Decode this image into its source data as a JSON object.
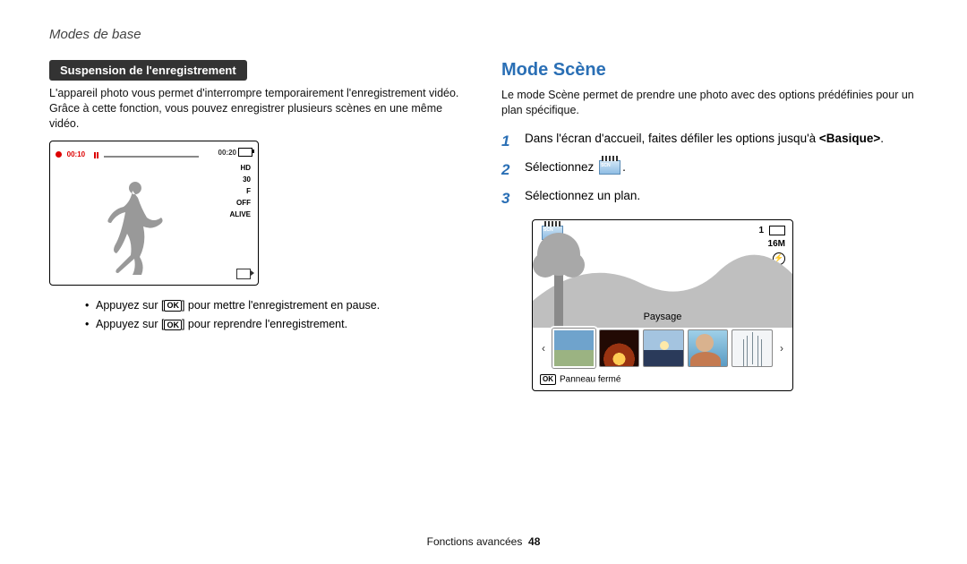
{
  "header": "Modes de base",
  "left": {
    "pill": "Suspension de l'enregistrement",
    "intro": "L'appareil photo vous permet d'interrompre temporairement l'enregistrement vidéo. Grâce à cette fonction, vous pouvez enregistrer plusieurs scènes en une même vidéo.",
    "screen": {
      "time_elapsed": "00:10",
      "time_total": "00:20",
      "labels": {
        "hd": "HD",
        "fps": "30",
        "f": "F",
        "off": "OFF",
        "alive": "ALIVE"
      }
    },
    "bullets": [
      {
        "pre": "Appuyez sur [",
        "ok": "OK",
        "post": "] pour mettre l'enregistrement en pause."
      },
      {
        "pre": "Appuyez sur [",
        "ok": "OK",
        "post": "] pour reprendre l'enregistrement."
      }
    ]
  },
  "right": {
    "h2": "Mode Scène",
    "intro": "Le mode Scène permet de prendre une photo avec des options prédéfinies pour un plan spécifique.",
    "steps": [
      {
        "n": "1",
        "pre": "Dans l'écran d'accueil, faites défiler les options jusqu'à ",
        "bold": "<Basique>",
        "post": "."
      },
      {
        "n": "2",
        "text": "Sélectionnez ",
        "icon_text": "SCN",
        "tail": "."
      },
      {
        "n": "3",
        "text": "Sélectionnez un plan."
      }
    ],
    "screen": {
      "top_scn": "SCN",
      "top_right_num": "1",
      "size_label": "16M",
      "flash": "⚡",
      "scene_label": "Paysage",
      "ok": "OK",
      "panel_label": "Panneau fermé"
    }
  },
  "footer": {
    "section": "Fonctions avancées",
    "page": "48"
  }
}
